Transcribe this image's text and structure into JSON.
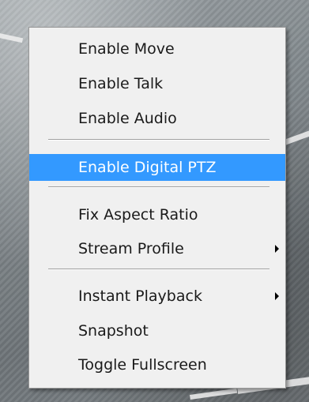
{
  "menu": {
    "items": [
      {
        "label": "Enable Move"
      },
      {
        "label": "Enable Talk"
      },
      {
        "label": "Enable Audio"
      },
      {
        "label": "Enable Digital PTZ",
        "highlighted": true
      },
      {
        "label": "Fix Aspect Ratio"
      },
      {
        "label": "Stream Profile",
        "submenu": true
      },
      {
        "label": "Instant Playback",
        "submenu": true
      },
      {
        "label": "Snapshot"
      },
      {
        "label": "Toggle Fullscreen"
      }
    ]
  },
  "colors": {
    "highlight": "#3399ff",
    "menu_background": "#f0f0f0",
    "text": "#1a1a1a"
  }
}
